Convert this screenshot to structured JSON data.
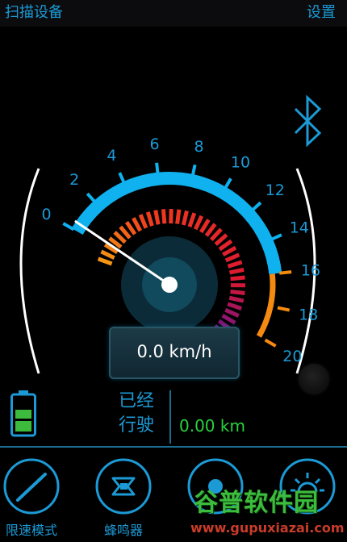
{
  "header": {
    "scan_label": "扫描设备",
    "settings_label": "设置"
  },
  "speedometer": {
    "ticks": [
      "0",
      "2",
      "4",
      "6",
      "8",
      "10",
      "12",
      "14",
      "16",
      "18",
      "20"
    ],
    "max": 20,
    "value": 0,
    "readout": "0.0 km/h",
    "colors": {
      "arc_blue": "#0fb1ee",
      "arc_orange": "#f58a10"
    }
  },
  "status": {
    "traveled_line1": "已经",
    "traveled_line2": "行驶",
    "distance": "0.00 km",
    "battery_level": 0.4
  },
  "bottom_buttons": [
    {
      "label": "限速模式",
      "icon": "speed-limit-icon"
    },
    {
      "label": "蜂鸣器",
      "icon": "horn-icon"
    },
    {
      "label": "",
      "icon": "light-dot-icon"
    },
    {
      "label": "",
      "icon": "headlight-icon"
    }
  ],
  "watermark": {
    "title": "谷普软件园",
    "url": "www.gupuxiazai.com"
  }
}
